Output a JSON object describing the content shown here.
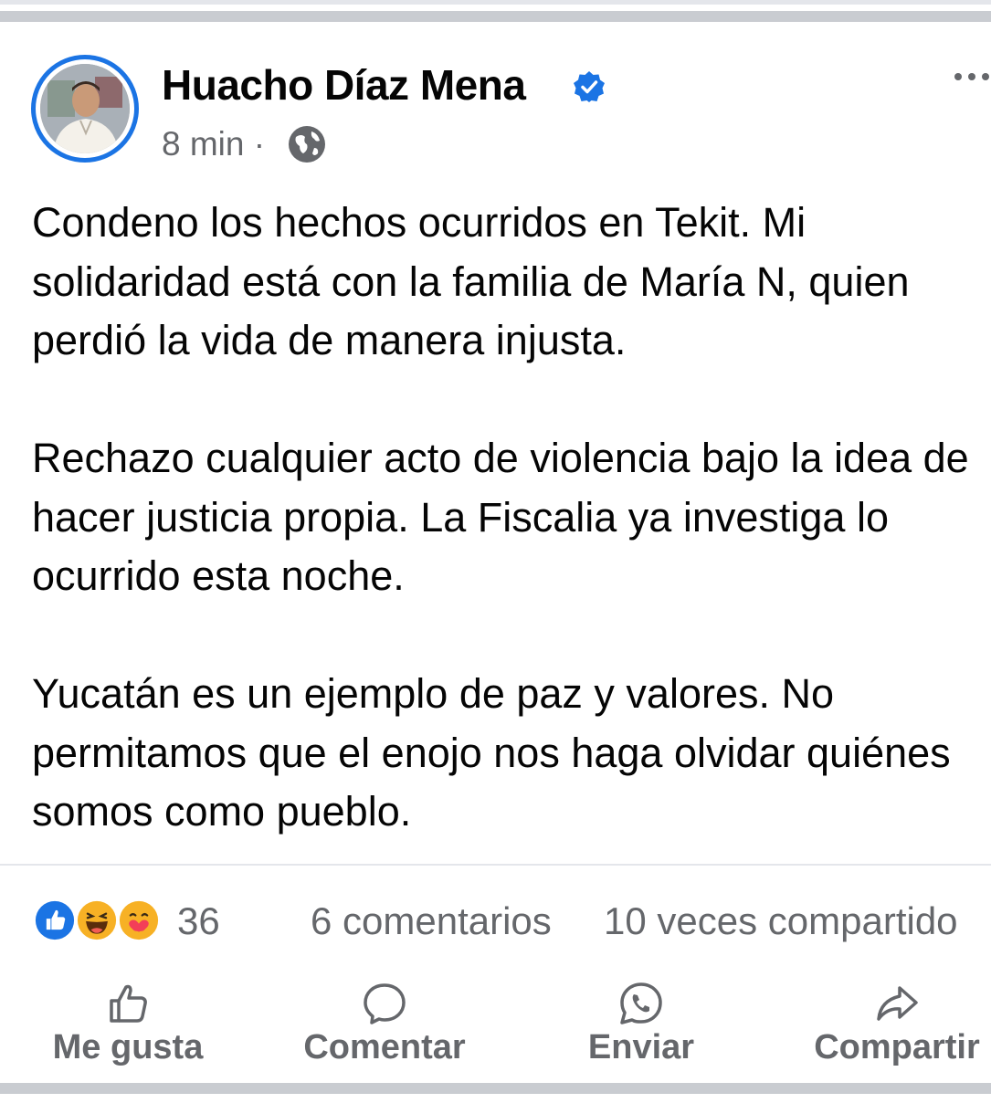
{
  "post": {
    "author": "Huacho Díaz Mena",
    "time": "8 min",
    "separator": "·",
    "paragraphs": [
      "Condeno los hechos ocurridos en Tekit. Mi solidaridad está con la familia de María N, quien perdió la vida de manera injusta.",
      "Rechazo cualquier acto de violencia bajo la idea de hacer justicia propia. La Fiscalia ya investiga lo ocurrido esta noche.",
      "Yucatán es un ejemplo de paz y valores. No permitamos que el enojo nos haga olvidar quiénes somos como pueblo."
    ]
  },
  "stats": {
    "reactions_count": "36",
    "comments": "6 comentarios",
    "shares": "10 veces compartido"
  },
  "actions": {
    "like": "Me gusta",
    "comment": "Comentar",
    "send": "Enviar",
    "share": "Compartir"
  },
  "icons": {
    "verified": "verified-badge-icon",
    "audience": "globe-icon",
    "more": "more-options-icon",
    "reactions": [
      "like-reaction-icon",
      "haha-reaction-icon",
      "care-reaction-icon"
    ]
  },
  "colors": {
    "accent": "#1b74e4",
    "secondary_text": "#65676b",
    "separator": "#c9ccd1"
  }
}
